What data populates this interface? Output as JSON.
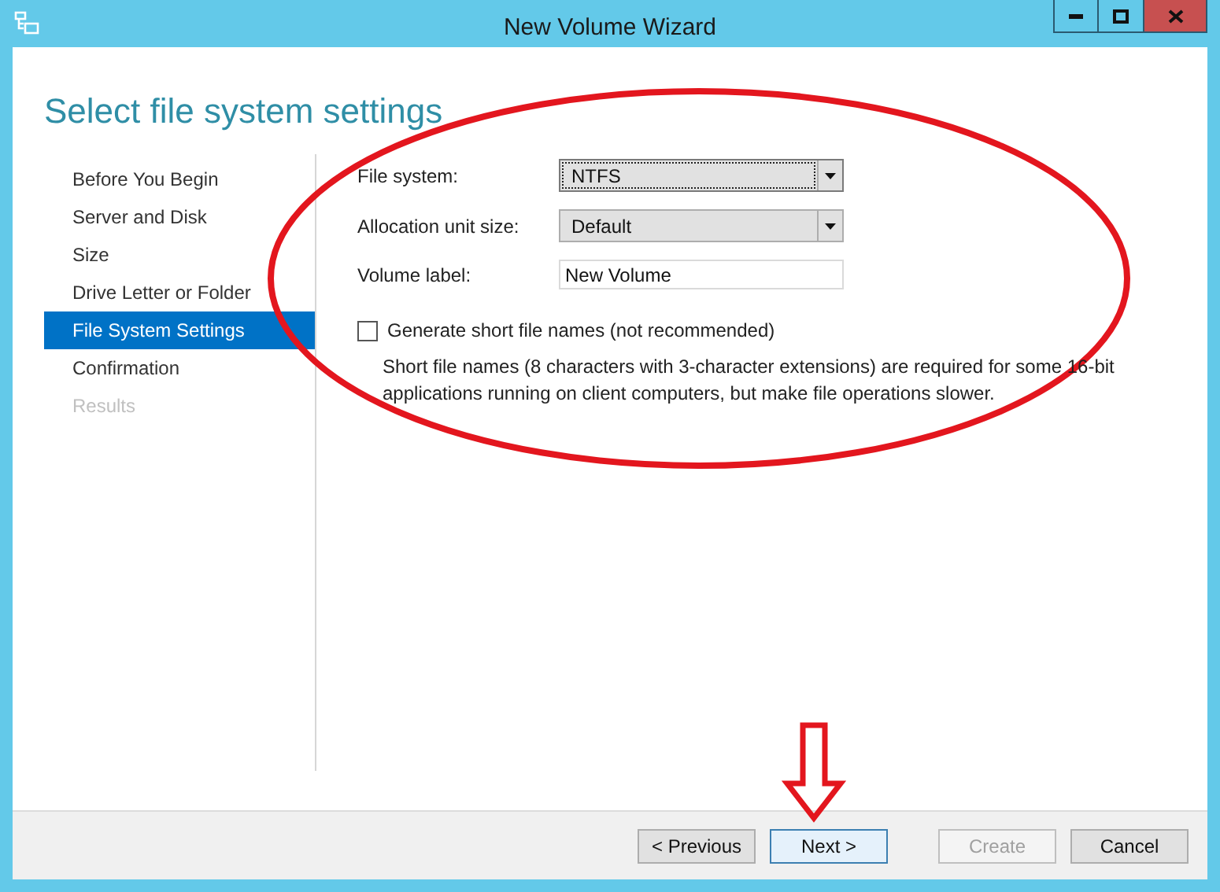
{
  "window": {
    "title": "New Volume Wizard"
  },
  "heading": "Select file system settings",
  "steps": [
    {
      "label": "Before You Begin",
      "selected": false,
      "disabled": false
    },
    {
      "label": "Server and Disk",
      "selected": false,
      "disabled": false
    },
    {
      "label": "Size",
      "selected": false,
      "disabled": false
    },
    {
      "label": "Drive Letter or Folder",
      "selected": false,
      "disabled": false
    },
    {
      "label": "File System Settings",
      "selected": true,
      "disabled": false
    },
    {
      "label": "Confirmation",
      "selected": false,
      "disabled": false
    },
    {
      "label": "Results",
      "selected": false,
      "disabled": true
    }
  ],
  "fields": [
    {
      "kind": "dropdown",
      "label": "File system:",
      "value": "NTFS",
      "focused": true
    },
    {
      "kind": "dropdown",
      "label": "Allocation unit size:",
      "value": "Default",
      "focused": false
    },
    {
      "kind": "text",
      "label": "Volume label:",
      "value": "New Volume",
      "focused": false
    }
  ],
  "short_names": {
    "label": "Generate short file names (not recommended)",
    "checked": false,
    "description": "Short file names (8 characters with 3-character extensions) are required for some 16-bit applications running on client computers, but make file operations slower."
  },
  "buttons": [
    {
      "label": "< Previous",
      "disabled": false,
      "default": false
    },
    {
      "label": "Next >",
      "disabled": false,
      "default": true
    },
    {
      "label": "Create",
      "disabled": true,
      "default": false
    },
    {
      "label": "Cancel",
      "disabled": false,
      "default": false
    }
  ],
  "annotations": {
    "ellipse": true,
    "arrow": true
  }
}
